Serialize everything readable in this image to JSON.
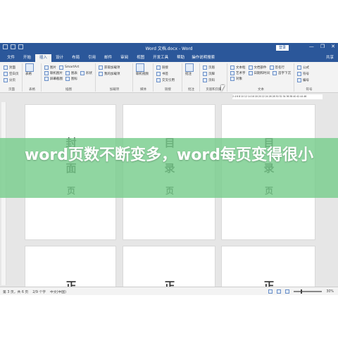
{
  "window": {
    "title": "Word 文档.docx - Word",
    "login_label": "登录",
    "controls": [
      "—",
      "❐",
      "✕"
    ]
  },
  "tabs": [
    "文件",
    "开始",
    "插入",
    "设计",
    "布局",
    "引用",
    "邮件",
    "审阅",
    "视图",
    "开发工具",
    "帮助"
  ],
  "active_tab_index": 2,
  "tell_me": "操作说明搜索",
  "share_label": "共享",
  "ribbon": {
    "groups": [
      {
        "label": "页面",
        "items": [
          "封面",
          "空白页",
          "分页"
        ]
      },
      {
        "label": "表格",
        "items": [
          "表格"
        ]
      },
      {
        "label": "插图",
        "items": [
          "图片",
          "联机图片",
          "形状",
          "图标",
          "SmartArt",
          "图表",
          "屏幕截图"
        ]
      },
      {
        "label": "加载项",
        "items": [
          "获取加载项",
          "我的加载项"
        ]
      },
      {
        "label": "媒体",
        "items": [
          "联机视频"
        ]
      },
      {
        "label": "链接",
        "items": [
          "链接",
          "书签",
          "交叉引用"
        ]
      },
      {
        "label": "批注",
        "items": [
          "批注"
        ]
      },
      {
        "label": "页眉和页脚",
        "items": [
          "页眉",
          "页脚",
          "页码"
        ]
      },
      {
        "label": "文本",
        "items": [
          "文本框",
          "文档部件",
          "艺术字",
          "首字下沉",
          "签名行",
          "日期和时间",
          "对象"
        ]
      },
      {
        "label": "符号",
        "items": [
          "公式",
          "符号",
          "编号"
        ]
      }
    ]
  },
  "ruler_text": "2 4 6 8 10 12 14 16 18 20 22 24 26 28 30 32 34 36 38 40 42 44 46",
  "pages": {
    "top_row": [
      {
        "chars": [
          "封",
          "面",
          "页"
        ]
      },
      {
        "chars": [
          "目",
          "录",
          "页"
        ]
      },
      {
        "chars": [
          "目",
          "录",
          "页"
        ]
      }
    ],
    "bottom_row": [
      {
        "chars": [
          "正"
        ]
      },
      {
        "chars": [
          "正"
        ]
      },
      {
        "chars": [
          "正"
        ]
      }
    ]
  },
  "status": {
    "page": "第 3 页，共 6 页",
    "words": "2/9 个字",
    "language": "中文(中国)",
    "zoom": "30%"
  },
  "banner": {
    "text": "word页数不断变多，word每页变得很小",
    "color": "#78cd8c"
  }
}
